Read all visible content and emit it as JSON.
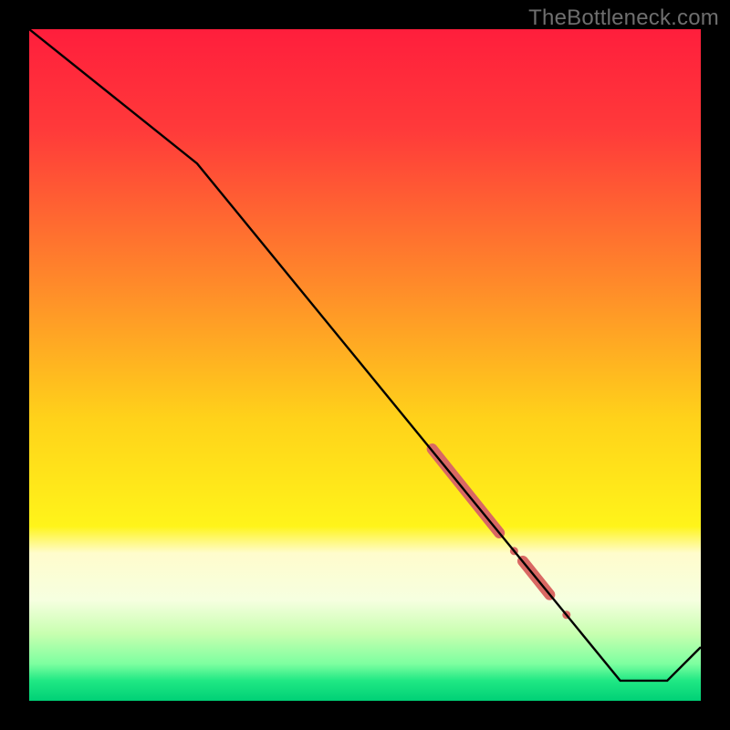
{
  "watermark": "TheBottleneck.com",
  "chart_data": {
    "type": "line",
    "title": "",
    "xlabel": "",
    "ylabel": "",
    "xlim": [
      0,
      100
    ],
    "ylim": [
      0,
      100
    ],
    "grid": false,
    "legend": false,
    "series": [
      {
        "name": "bottleneck-curve",
        "x": [
          0,
          25,
          88,
          95,
          100
        ],
        "y": [
          100,
          80,
          3,
          3,
          8
        ],
        "stroke": "#000000"
      }
    ],
    "highlights": [
      {
        "name": "segment-a",
        "x0": 60,
        "y0": 37.5,
        "x1": 70,
        "y1": 25,
        "width": 12,
        "color": "#d96863"
      },
      {
        "name": "dot-a",
        "cx": 72.2,
        "cy": 22.3,
        "r": 4.5,
        "color": "#d96863"
      },
      {
        "name": "segment-b",
        "x0": 73.5,
        "y0": 20.8,
        "x1": 77.5,
        "y1": 15.8,
        "width": 12,
        "color": "#d96863"
      },
      {
        "name": "dot-b",
        "cx": 80,
        "cy": 12.8,
        "r": 4.5,
        "color": "#d96863"
      }
    ],
    "gradient_stops": [
      {
        "offset": 0.0,
        "color": "#ff1e3c"
      },
      {
        "offset": 0.15,
        "color": "#ff3a3a"
      },
      {
        "offset": 0.38,
        "color": "#ff8a2a"
      },
      {
        "offset": 0.58,
        "color": "#ffd21a"
      },
      {
        "offset": 0.74,
        "color": "#fff41a"
      },
      {
        "offset": 0.78,
        "color": "#fffccc"
      },
      {
        "offset": 0.85,
        "color": "#f6ffe0"
      },
      {
        "offset": 0.9,
        "color": "#c8ffb0"
      },
      {
        "offset": 0.945,
        "color": "#7dffa0"
      },
      {
        "offset": 0.97,
        "color": "#20e884"
      },
      {
        "offset": 1.0,
        "color": "#00d076"
      }
    ]
  }
}
